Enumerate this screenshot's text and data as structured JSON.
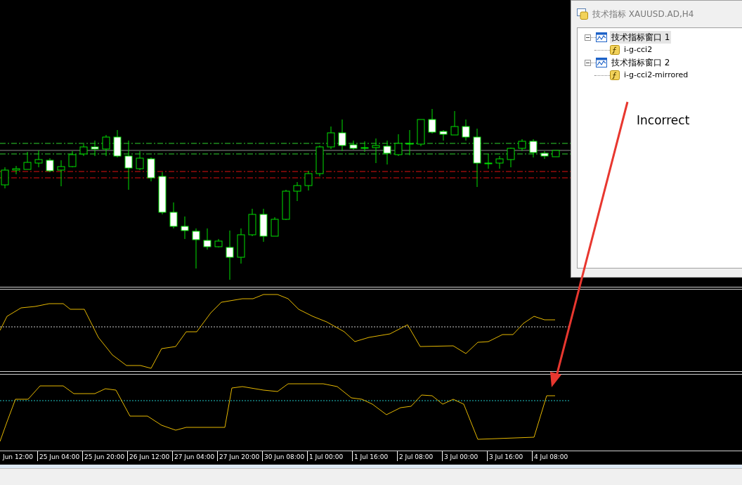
{
  "window": {
    "title": "技术指标 XAUUSD.AD,H4"
  },
  "indicator_tree": [
    {
      "label": "技术指标窗口 1",
      "selected": true,
      "expanded": true,
      "children": [
        {
          "label": "i-g-cci2"
        }
      ]
    },
    {
      "label": "技术指标窗口 2",
      "selected": false,
      "expanded": true,
      "children": [
        {
          "label": "i-g-cci2-mirrored"
        }
      ]
    }
  ],
  "annotation": {
    "text": "Incorrect"
  },
  "time_axis": {
    "labels": [
      "Jun 12:00",
      "25 Jun 04:00",
      "25 Jun 20:00",
      "26 Jun 12:00",
      "27 Jun 04:00",
      "27 Jun 20:00",
      "30 Jun 08:00",
      "1 Jul 00:00",
      "1 Jul 16:00",
      "2 Jul 08:00",
      "3 Jul 00:00",
      "3 Jul 16:00",
      "4 Jul 08:00"
    ]
  }
}
